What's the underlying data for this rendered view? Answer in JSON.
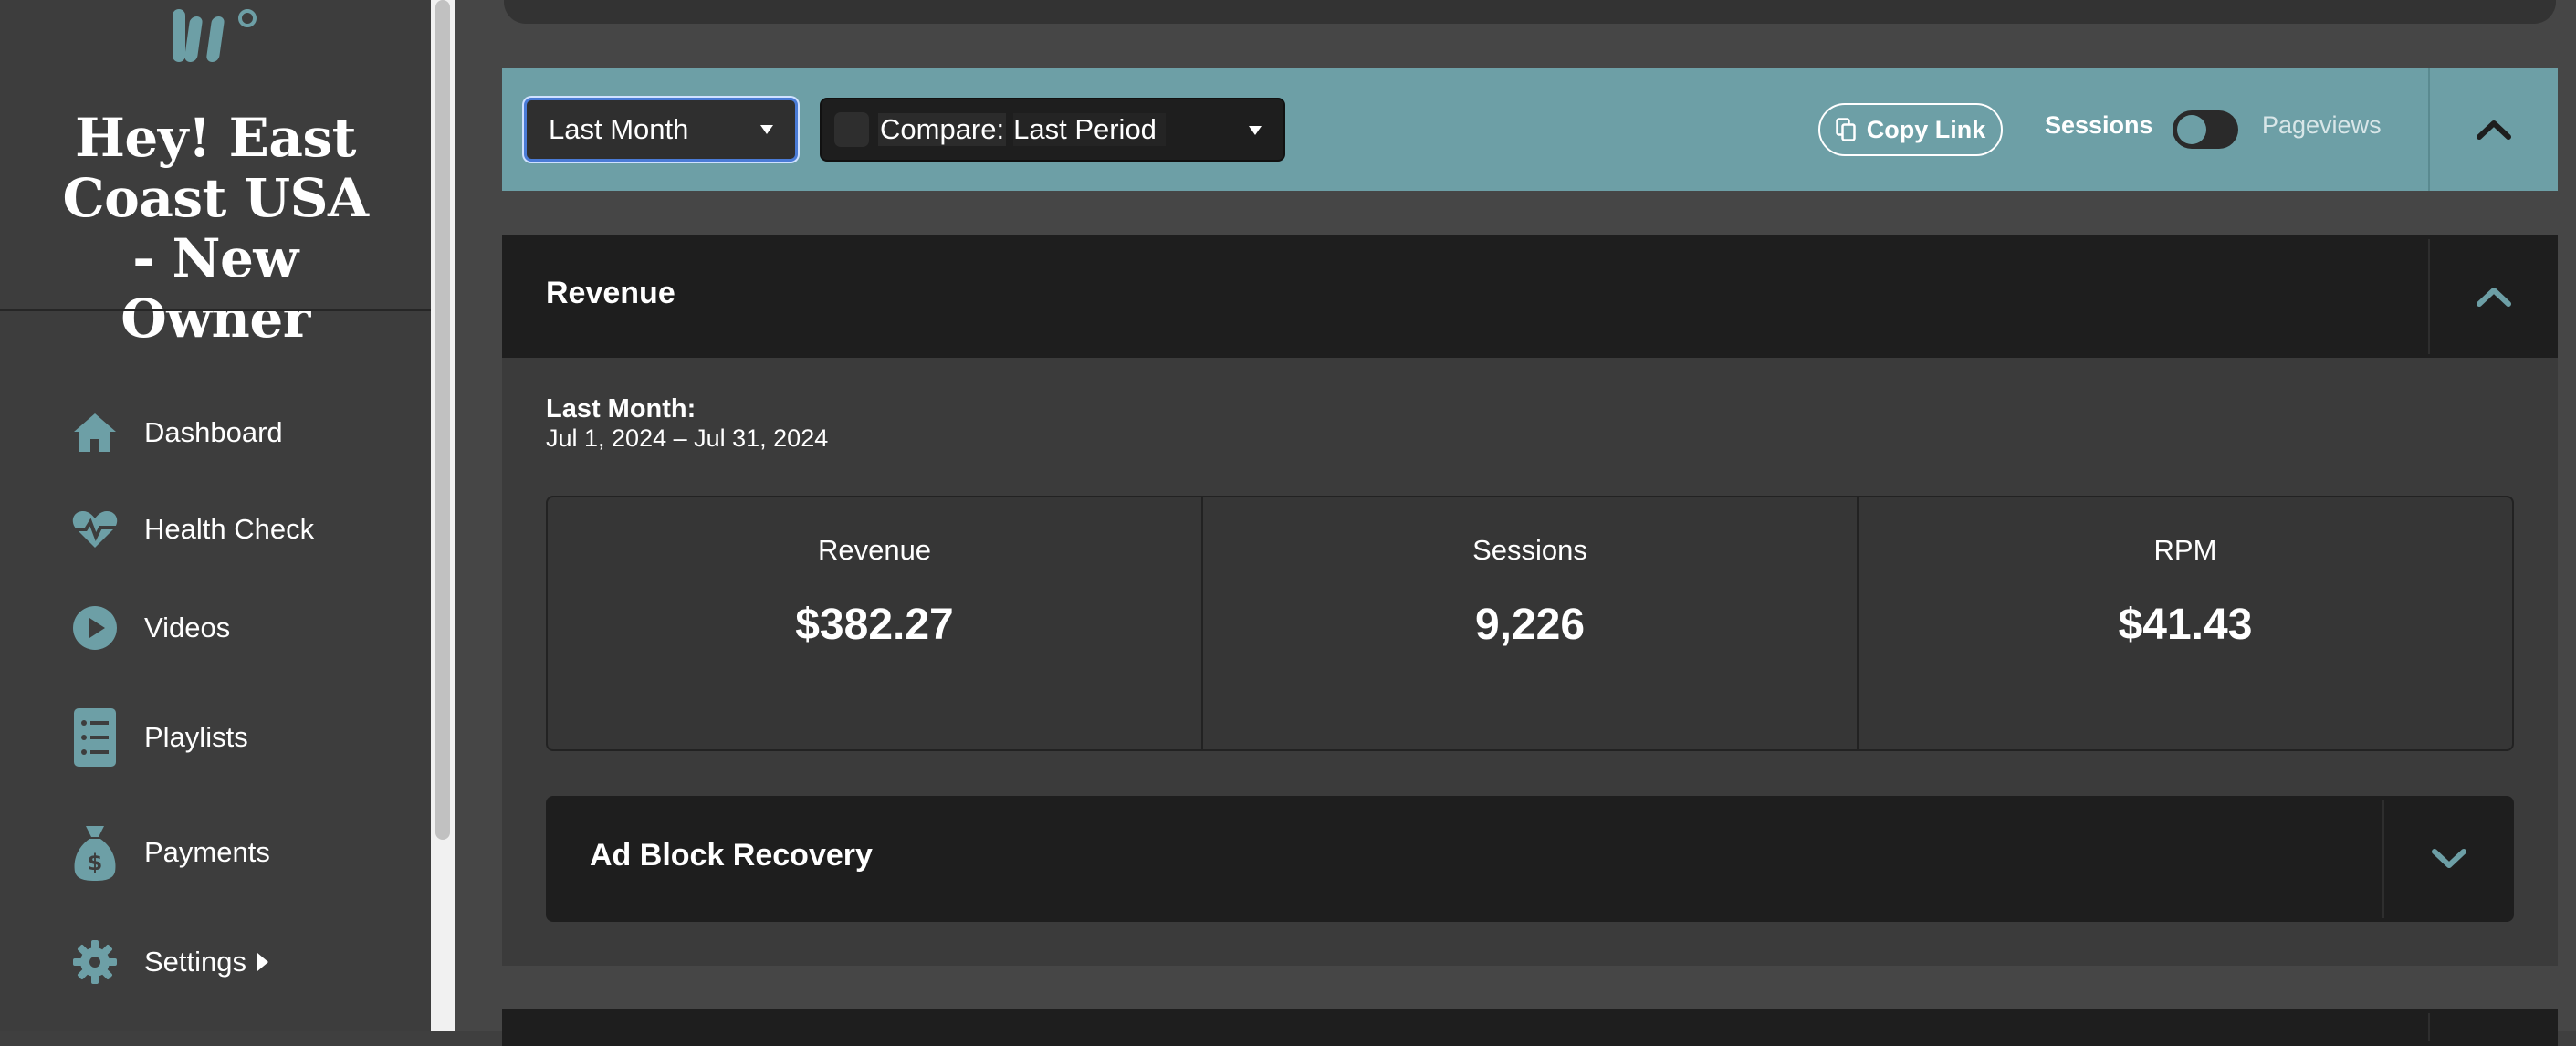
{
  "sidebar": {
    "logo_icon": "brand-logo-icon",
    "site_title": "Hey! East Coast USA - New Owner",
    "items": [
      {
        "label": "Dashboard",
        "icon": "home-icon"
      },
      {
        "label": "Health Check",
        "icon": "heart-pulse-icon"
      },
      {
        "label": "Videos",
        "icon": "play-circle-icon"
      },
      {
        "label": "Playlists",
        "icon": "checklist-icon"
      },
      {
        "label": "Payments",
        "icon": "money-bag-icon"
      },
      {
        "label": "Settings",
        "icon": "gear-icon"
      }
    ]
  },
  "filters": {
    "period_selected": "Last Month",
    "compare_prefix": "Compare:",
    "compare_selected": "Last Period",
    "copy_link_label": "Copy Link",
    "toggle_left_label": "Sessions",
    "toggle_right_label": "Pageviews",
    "toggle_state": "Sessions"
  },
  "revenue": {
    "title": "Revenue",
    "period_label": "Last Month:",
    "period_range": "Jul 1, 2024 – Jul 31, 2024",
    "stats": [
      {
        "label": "Revenue",
        "value": "$382.27"
      },
      {
        "label": "Sessions",
        "value": "9,226"
      },
      {
        "label": "RPM",
        "value": "$41.43"
      }
    ]
  },
  "ad_block_recovery": {
    "title": "Ad Block Recovery"
  },
  "colors": {
    "accent": "#6d9fa6",
    "panel_dark": "#1e1e1e",
    "sidebar_bg": "#3d3d3d"
  }
}
